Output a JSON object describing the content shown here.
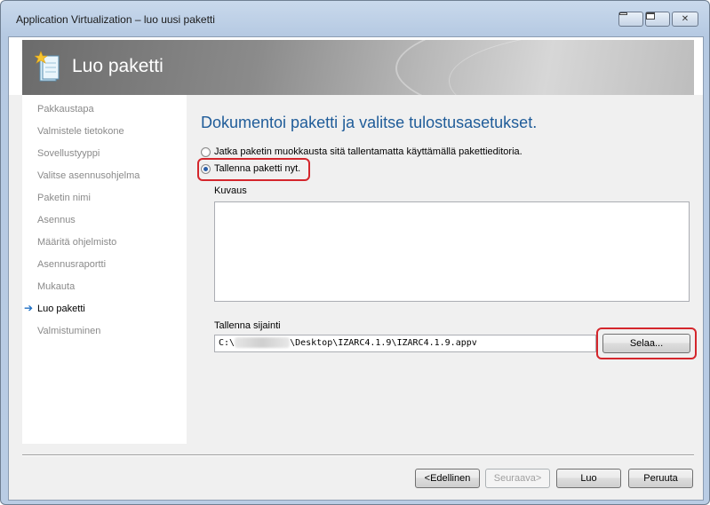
{
  "window": {
    "title": "Application Virtualization – luo uusi paketti"
  },
  "banner": {
    "title": "Luo paketti"
  },
  "sidebar": {
    "items": [
      {
        "label": "Pakkaustapa"
      },
      {
        "label": "Valmistele tietokone"
      },
      {
        "label": "Sovellustyyppi"
      },
      {
        "label": "Valitse asennusohjelma"
      },
      {
        "label": "Paketin nimi"
      },
      {
        "label": "Asennus"
      },
      {
        "label": "Määritä ohjelmisto"
      },
      {
        "label": "Asennusraportti"
      },
      {
        "label": "Mukauta"
      },
      {
        "label": "Luo paketti"
      },
      {
        "label": "Valmistuminen"
      }
    ],
    "current_index": 9
  },
  "main": {
    "heading": "Dokumentoi paketti ja valitse tulostusasetukset.",
    "option_edit": "Jatka paketin muokkausta sitä tallentamatta käyttämällä pakettieditoria.",
    "option_save": "Tallenna paketti nyt.",
    "selected_option": "option_save",
    "description_label": "Kuvaus",
    "description_value": "",
    "save_location_label": "Tallenna sijainti",
    "save_location_prefix": "C:\\",
    "save_location_suffix": "\\Desktop\\IZARC4.1.9\\IZARC4.1.9.appv",
    "browse_label": "Selaa..."
  },
  "footer": {
    "back_label": "<Edellinen",
    "next_label": "Seuraava>",
    "create_label": "Luo",
    "cancel_label": "Peruuta"
  },
  "colors": {
    "heading": "#1f5c99",
    "highlight": "#d4262c",
    "current_step_arrow": "#1f6fc4"
  }
}
